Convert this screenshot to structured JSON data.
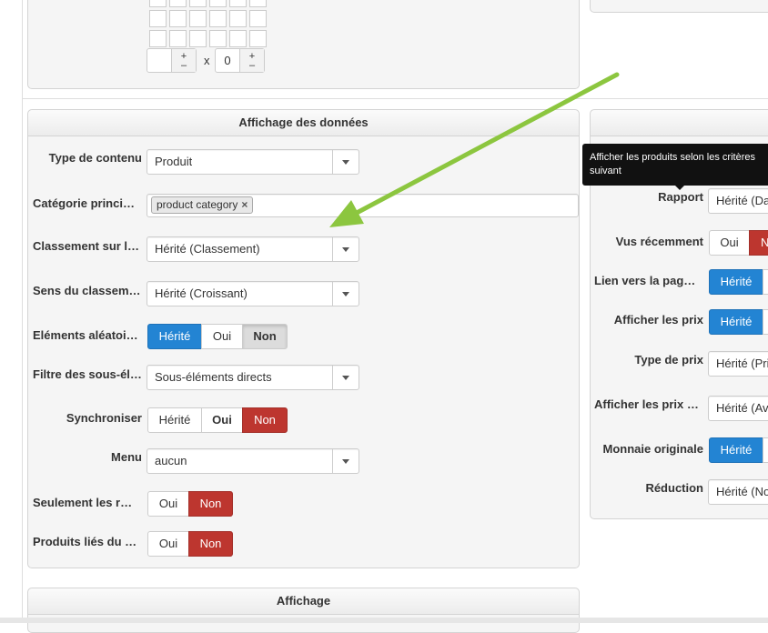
{
  "top_panel": {
    "dim_cols": "",
    "x_label": "x",
    "dim_rows": "0",
    "plus": "+",
    "minus": "–"
  },
  "display_panel": {
    "title": "Affichage des données",
    "fields": {
      "content_type": {
        "label": "Type de contenu",
        "value": "Produit"
      },
      "main_category": {
        "label": "Catégorie princi…",
        "tag": "product category",
        "tag_remove": "×"
      },
      "ordering": {
        "label": "Classement sur l…",
        "value": "Hérité (Classement)"
      },
      "order_dir": {
        "label": "Sens du classem…",
        "value": "Hérité (Croissant)"
      },
      "random": {
        "label": "Eléments aléatoi…",
        "options": [
          "Hérité",
          "Oui",
          "Non"
        ]
      },
      "sub_filter": {
        "label": "Filtre des sous-él…",
        "value": "Sous-éléments directs"
      },
      "sync": {
        "label": "Synchroniser",
        "options": [
          "Hérité",
          "Oui",
          "Non"
        ]
      },
      "menu": {
        "label": "Menu",
        "value": "aucun"
      },
      "only_main": {
        "label": "Seulement les r…",
        "options": [
          "Oui",
          "Non"
        ]
      },
      "related": {
        "label": "Produits liés du …",
        "options": [
          "Oui",
          "Non"
        ]
      }
    }
  },
  "bottom_panel": {
    "title": "Affichage"
  },
  "right_panel": {
    "tooltip": "Afficher les produits selon les critères suivant",
    "fields": {
      "report": {
        "label": "Rapport",
        "value": "Hérité (Da"
      },
      "recent": {
        "label": "Vus récemment",
        "options": [
          "Oui",
          "N"
        ]
      },
      "link": {
        "label": "Lien vers la pag…",
        "options": [
          "Hérité"
        ]
      },
      "show_price": {
        "label": "Afficher les prix",
        "options": [
          "Hérité"
        ]
      },
      "price_type": {
        "label": "Type de prix",
        "value": "Hérité (Pri"
      },
      "show_price2": {
        "label": "Afficher les prix …",
        "value": "Hérité (Av"
      },
      "orig_currency": {
        "label": "Monnaie originale",
        "options": [
          "Hérité"
        ]
      },
      "discount": {
        "label": "Réduction",
        "value": "Hérité (No"
      }
    }
  },
  "colors": {
    "active_blue": "#2384d3",
    "active_red": "#bd362f",
    "arrow_green": "#8cc63f"
  }
}
